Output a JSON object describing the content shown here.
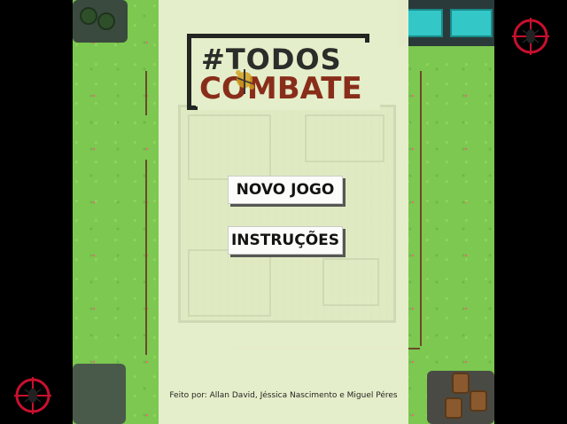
{
  "game": {
    "logo": {
      "line1": "#TODOS NO",
      "line2": "COMBATE"
    },
    "menu": {
      "new_game_label": "NOVO JOGO",
      "instructions_label": "INSTRUÇÕES"
    },
    "credits": "Feito por: Allan David, Jéssica Nascimento e Miguel Péres"
  },
  "colors": {
    "grass": "#7cc850",
    "panel": "#e8efcd",
    "logo_dark": "#2a2a2a",
    "logo_red": "#8a2a1a",
    "target_red": "#c8102e"
  },
  "icons": [
    "mosquito-target-icon"
  ]
}
